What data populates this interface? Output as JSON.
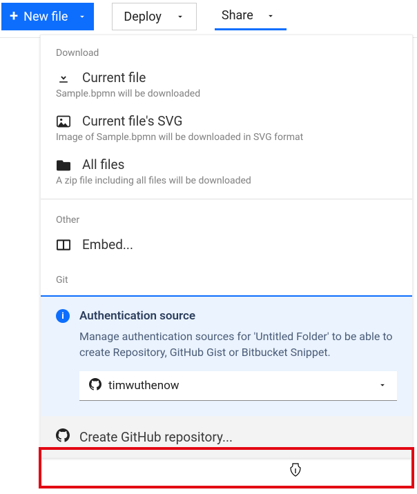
{
  "toolbar": {
    "newFile": "New file",
    "deploy": "Deploy",
    "share": "Share"
  },
  "panel": {
    "downloadLabel": "Download",
    "currentFile": {
      "title": "Current file",
      "subtitle": "Sample.bpmn will be downloaded"
    },
    "currentSvg": {
      "title": "Current file's SVG",
      "subtitle": "Image of Sample.bpmn will be downloaded in SVG format"
    },
    "allFiles": {
      "title": "All files",
      "subtitle": "A zip file including all files will be downloaded"
    },
    "otherLabel": "Other",
    "embed": {
      "title": "Embed..."
    },
    "gitLabel": "Git",
    "auth": {
      "title": "Authentication source",
      "desc": "Manage authentication sources for 'Untitled Folder' to be able to create Repository, GitHub Gist or Bitbucket Snippet.",
      "selected": "timwuthenow"
    },
    "createRepo": {
      "title": "Create GitHub repository..."
    }
  }
}
